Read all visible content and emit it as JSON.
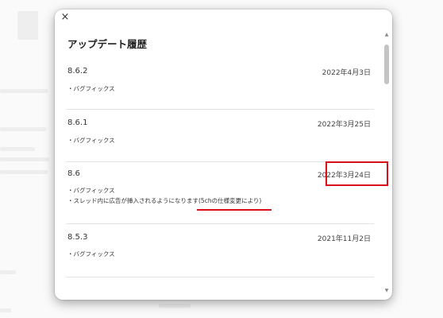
{
  "dialog": {
    "close_glyph": "×",
    "title": "アップデート履歴"
  },
  "entries": [
    {
      "version": "8.6.2",
      "date": "2022年4月3日",
      "notes": [
        "・バグフィックス"
      ]
    },
    {
      "version": "8.6.1",
      "date": "2022年3月25日",
      "notes": [
        "・バグフィックス"
      ]
    },
    {
      "version": "8.6",
      "date": "2022年3月24日",
      "notes": [
        "・バグフィックス",
        "・スレッド内に広告が挿入されるようになります(5chの仕様変更により)"
      ]
    },
    {
      "version": "8.5.3",
      "date": "2021年11月2日",
      "notes": [
        "・バグフィックス"
      ]
    }
  ],
  "colors": {
    "annotation_red": "#d8101a"
  }
}
